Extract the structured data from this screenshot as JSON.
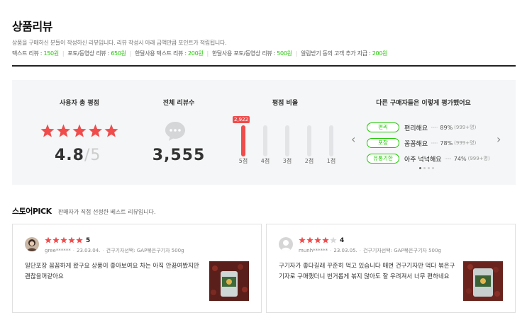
{
  "header": {
    "title": "상품리뷰",
    "description": "상품을 구매하신 분들이 작성하신 리뷰입니다. 리뷰 작성시 아래 금액만큼 포인트가 적립됩니다.",
    "points": [
      {
        "label": "텍스트 리뷰",
        "amount": "150원"
      },
      {
        "label": "포토/동영상 리뷰",
        "amount": "650원"
      },
      {
        "label": "한달사용 텍스트 리뷰",
        "amount": "200원"
      },
      {
        "label": "한달사용 포토/동영상 리뷰",
        "amount": "500원"
      },
      {
        "label": "알림받기 동의 고객 추가 지급",
        "amount": "200원"
      }
    ]
  },
  "summary": {
    "rating_title": "사용자 총 평점",
    "rating": "4.8",
    "rating_max": "/5",
    "rating_value": 4.8,
    "count_title": "전체 리뷰수",
    "count": "3,555",
    "ratio_title": "평점 비율",
    "ratio_top_badge": "2,922",
    "ratio_bars": [
      {
        "label": "5점",
        "fraction": 1.0
      },
      {
        "label": "4점",
        "fraction": 0.0
      },
      {
        "label": "3점",
        "fraction": 0.0
      },
      {
        "label": "2점",
        "fraction": 0.0
      },
      {
        "label": "1점",
        "fraction": 0.0
      }
    ],
    "others_title": "다른 구매자들은 이렇게 평가했어요",
    "others": [
      {
        "tag": "편리",
        "phrase": "편리해요",
        "pct": "89%",
        "count": "(999+명)"
      },
      {
        "tag": "포장",
        "phrase": "꼼꼼해요",
        "pct": "78%",
        "count": "(999+명)"
      },
      {
        "tag": "유통기한",
        "phrase": "아주 넉넉해요",
        "pct": "74%",
        "count": "(999+명)"
      }
    ],
    "prev_arrow": "‹",
    "next_arrow": "›"
  },
  "pick": {
    "title": "스토어PICK",
    "subtitle": "판매자가 직접 선정한 베스트 리뷰입니다."
  },
  "reviews": [
    {
      "score": "5",
      "rating": 5,
      "user": "gree******",
      "date": "23.03.04.",
      "option": "건구기자선택: GAP볶은구기자 500g",
      "text": "일단포장 꼼꼼하게 왔구요 상품이 좋아보여요 차는 아직 안끓여봤지만 괜찮을꺼같아요"
    },
    {
      "score": "4",
      "rating": 4,
      "user": "munh******",
      "date": "23.03.05.",
      "option": "건구기자선택: GAP볶은구기자 500g",
      "text": "구기자가 좋다길래 꾸준히 먹고 있습니다 매번 건구기자만 먹다 볶은구기자로 구매했더니 번거롭게 볶지 않아도 잘 우려져서 너무 편하네요"
    }
  ],
  "colors": {
    "accent": "#1ec800",
    "star": "#f04c4c",
    "text": "#222222"
  }
}
